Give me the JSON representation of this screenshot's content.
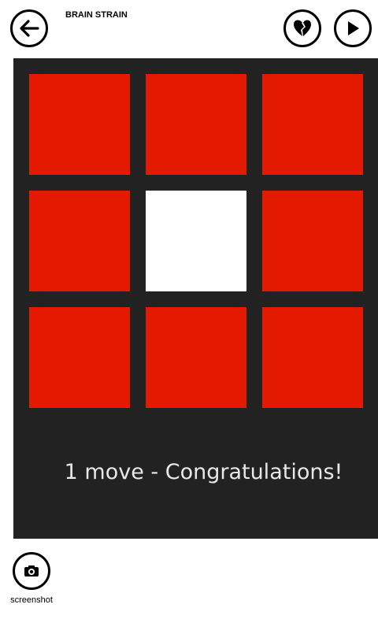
{
  "header": {
    "title": "BRAIN STRAIN",
    "back_icon": "back-arrow-icon",
    "heart_icon": "broken-heart-icon",
    "play_icon": "play-icon"
  },
  "game": {
    "grid_rows": 3,
    "grid_cols": 3,
    "tiles": [
      {
        "state": "red"
      },
      {
        "state": "red"
      },
      {
        "state": "red"
      },
      {
        "state": "red"
      },
      {
        "state": "white"
      },
      {
        "state": "red"
      },
      {
        "state": "red"
      },
      {
        "state": "red"
      },
      {
        "state": "red"
      }
    ],
    "status": "1 move - Congratulations!"
  },
  "colors": {
    "board_bg": "#222222",
    "tile_red": "#e31a00",
    "tile_white": "#ffffff"
  },
  "appbar": {
    "screenshot_label": "screenshot",
    "screenshot_icon": "camera-icon"
  }
}
